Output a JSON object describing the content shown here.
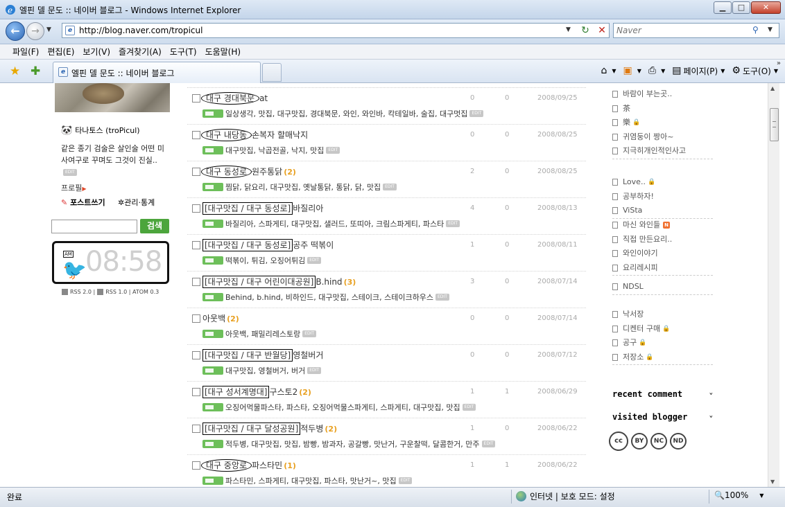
{
  "window": {
    "title": "엘핀 델 문도 :: 네이버 블로그 - Windows Internet Explorer",
    "buttons": [
      "minimize",
      "maximize",
      "close"
    ]
  },
  "nav": {
    "url": "http://blog.naver.com/tropicul",
    "search_placeholder": "Naver"
  },
  "menu": [
    "파일(F)",
    "편집(E)",
    "보기(V)",
    "즐겨찾기(A)",
    "도구(T)",
    "도움말(H)"
  ],
  "tab": {
    "label": "엘핀 델 문도 :: 네이버 블로그"
  },
  "commands": {
    "page": "페이지(P)",
    "tools": "도구(O)"
  },
  "profile": {
    "name": "타나토스 (troPicul)",
    "desc": "같은 종기 검술은 살인술 어떤 미사여구로 꾸며도 그것이 진실..",
    "profile_link": "프로필",
    "write": "포스트쓰기",
    "manage": "관리·통계",
    "search_button": "검색",
    "clock_ampm": "AM",
    "clock_time": "08:58",
    "rss": [
      "RSS 2.0",
      "RSS 1.0",
      "ATOM 0.3"
    ]
  },
  "edit_label": "EDIT",
  "posts": [
    {
      "category": "대구 경대북문",
      "style": "oval",
      "title": "at",
      "count": "",
      "v1": "0",
      "v2": "0",
      "date": "2008/09/25",
      "tags": "일상생각, 맛집, 대구맛집, 경대북문, 와인, 와인바, 칵테일바, 술집, 대구멋집"
    },
    {
      "category": "대구 내당동",
      "style": "oval",
      "title": "손복자 할매낙지",
      "count": "",
      "v1": "0",
      "v2": "0",
      "date": "2008/08/25",
      "tags": "대구맛집, 낙곱전골, 낙지, 맛집"
    },
    {
      "category": "대구 동성로",
      "style": "oval",
      "title": "원주통닭",
      "count": "(2)",
      "v1": "2",
      "v2": "0",
      "date": "2008/08/25",
      "tags": "찜닭, 닭요리, 대구맛집, 옛날통닭, 통닭, 닭, 맛집"
    },
    {
      "category": "[대구맛집 / 대구 동성로]",
      "style": "box",
      "title": "바질리아",
      "count": "",
      "v1": "4",
      "v2": "0",
      "date": "2008/08/13",
      "tags": "바질리아, 스파게티, 대구맛집, 샐러드, 또띠아, 크림스파게티, 파스타"
    },
    {
      "category": "[대구맛집 / 대구 동성로]",
      "style": "box",
      "title": "공주 떡볶이",
      "count": "",
      "v1": "1",
      "v2": "0",
      "date": "2008/08/11",
      "tags": "떡볶이, 튀김, 오징어튀김"
    },
    {
      "category": "[대구맛집 / 대구 어린이대공원]",
      "style": "box",
      "title": "B.hind",
      "count": "(3)",
      "v1": "3",
      "v2": "0",
      "date": "2008/07/14",
      "tags": "Behind, b.hind, 비하인드, 대구맛집, 스테이크, 스테이크하우스"
    },
    {
      "category": "",
      "style": "none",
      "title": "아웃백",
      "count": "(2)",
      "v1": "0",
      "v2": "0",
      "date": "2008/07/14",
      "tags": "아웃백, 패밀리레스토랑"
    },
    {
      "category": "[대구맛집 / 대구 반월당]",
      "style": "box",
      "title": "영철버거",
      "count": "",
      "v1": "0",
      "v2": "0",
      "date": "2008/07/12",
      "tags": "대구맛집, 영철버거, 버거"
    },
    {
      "category": "[대구 성서계명대]",
      "style": "box",
      "title": "구스토2",
      "count": "(2)",
      "v1": "1",
      "v2": "1",
      "date": "2008/06/29",
      "tags": "오징어먹물파스타, 파스타, 오징어먹물스파게티, 스파게티, 대구맛집, 맛집"
    },
    {
      "category": "[대구맛집 / 대구 달성공원]",
      "style": "box",
      "title": "적두병",
      "count": "(2)",
      "v1": "1",
      "v2": "0",
      "date": "2008/06/22",
      "tags": "적두병, 대구맛집, 맛집, 밤빵, 밤과자, 공갈빵, 맛난거, 구운찰떡, 달콤한거, 만주"
    },
    {
      "category": "대구 중앙로",
      "style": "oval",
      "title": "파스타민",
      "count": "(1)",
      "v1": "1",
      "v2": "1",
      "date": "2008/06/22",
      "tags": "파스타민, 스파게티, 대구맛집, 파스타, 맛난거~, 맛집"
    }
  ],
  "sidebar": {
    "groups": [
      [
        {
          "label": "바람이 부는곳..",
          "lock": false
        },
        {
          "label": "茶",
          "lock": false
        },
        {
          "label": "樂",
          "lock": true
        },
        {
          "label": "귀염둥이 짱아~",
          "lock": false
        },
        {
          "label": "지극히개인적인사고",
          "lock": false
        }
      ],
      [
        {
          "label": "Love..",
          "lock": true
        },
        {
          "label": "공부하자!",
          "lock": false
        },
        {
          "label": "ViSta",
          "lock": false
        }
      ],
      [
        {
          "label": "마신 와인들",
          "lock": false,
          "new": "N"
        },
        {
          "label": "직접 만든요리..",
          "lock": false
        },
        {
          "label": "와인이야기",
          "lock": false
        },
        {
          "label": "요리레시피",
          "lock": false
        }
      ],
      [
        {
          "label": "NDSL",
          "lock": false
        }
      ],
      [
        {
          "label": "낙서장",
          "lock": false
        },
        {
          "label": "디켄터 구매",
          "lock": true
        },
        {
          "label": "공구",
          "lock": true
        },
        {
          "label": "저장소",
          "lock": true
        }
      ]
    ],
    "recent_comment": "recent comment",
    "visited_blogger": "visited blogger",
    "cc": [
      "cc",
      "BY",
      "NC",
      "ND"
    ]
  },
  "status": {
    "text": "완료",
    "zone": "인터넷 | 보호 모드: 설정",
    "zoom": "100%"
  }
}
